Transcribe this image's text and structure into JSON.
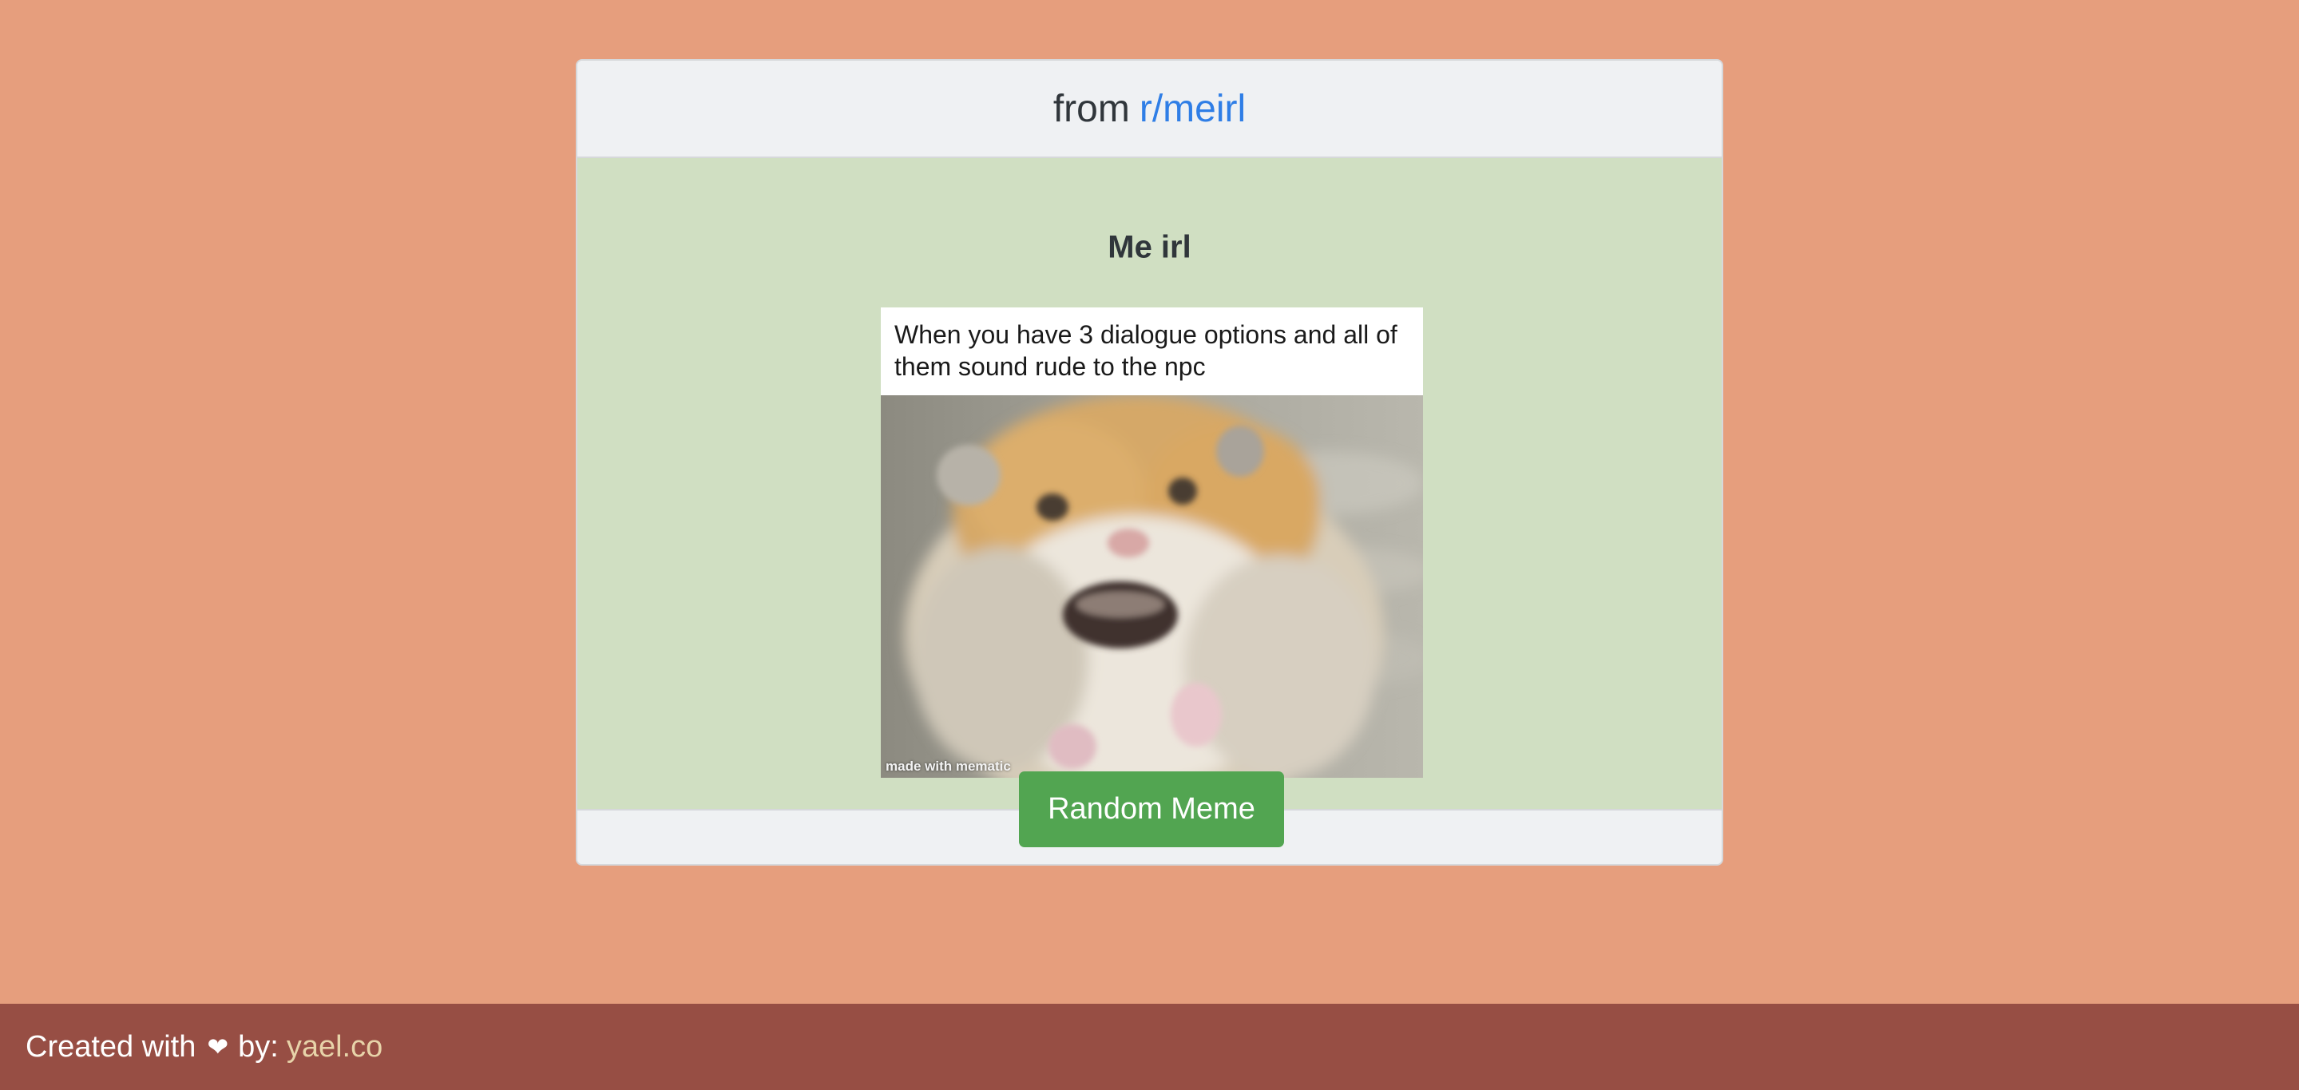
{
  "header": {
    "prefix": "from",
    "subreddit": "r/meirl"
  },
  "post": {
    "title": "Me irl",
    "meme_caption": "When you have 3 dialogue options and all of them sound rude to the npc",
    "watermark": "made with mematic",
    "image_subject": "startled-hamster"
  },
  "actions": {
    "random_label": "Random Meme"
  },
  "footer": {
    "created_text": "Created with",
    "heart_icon": "heart-icon",
    "by_text": "by:",
    "author_link": "yael.co"
  },
  "colors": {
    "page_background": "#e69e7d",
    "card_body": "#d0dfc2",
    "link": "#2f7ee6",
    "button": "#52a551",
    "footer_bar": "#974e44",
    "footer_link": "#e7d3a9"
  }
}
